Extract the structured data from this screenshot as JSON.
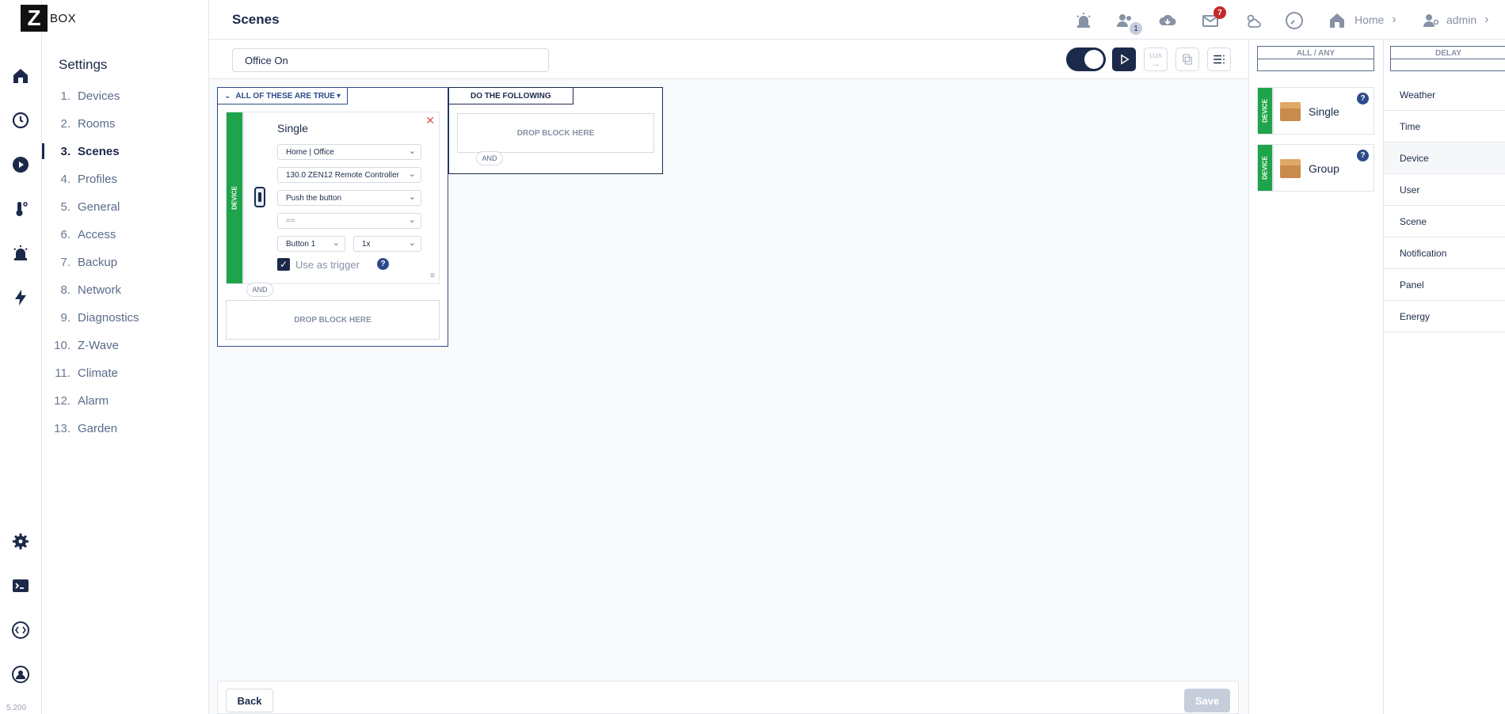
{
  "app": {
    "logo_letter": "Z",
    "logo_text": "BOX",
    "version": "5.200"
  },
  "header": {
    "title": "Scenes",
    "notifications_badge": "7",
    "users_badge": "1",
    "home_label": "Home",
    "user_label": "admin"
  },
  "settings": {
    "title": "Settings",
    "items": [
      {
        "num": "1.",
        "label": "Devices"
      },
      {
        "num": "2.",
        "label": "Rooms"
      },
      {
        "num": "3.",
        "label": "Scenes"
      },
      {
        "num": "4.",
        "label": "Profiles"
      },
      {
        "num": "5.",
        "label": "General"
      },
      {
        "num": "6.",
        "label": "Access"
      },
      {
        "num": "7.",
        "label": "Backup"
      },
      {
        "num": "8.",
        "label": "Network"
      },
      {
        "num": "9.",
        "label": "Diagnostics"
      },
      {
        "num": "10.",
        "label": "Z-Wave"
      },
      {
        "num": "11.",
        "label": "Climate"
      },
      {
        "num": "12.",
        "label": "Alarm"
      },
      {
        "num": "13.",
        "label": "Garden"
      }
    ],
    "active_index": 2
  },
  "toolbar": {
    "scene_name": "Office On",
    "lua_label": "LUA"
  },
  "conditions": {
    "header": "ALL OF THESE ARE TRUE",
    "block": {
      "category": "DEVICE",
      "title": "Single",
      "room": "Home | Office",
      "device": "130.0 ZEN12 Remote Controller",
      "action": "Push the button",
      "operator": "==",
      "button": "Button 1",
      "count": "1x",
      "trigger_label": "Use as trigger",
      "help": "?"
    },
    "and_label": "AND",
    "drop_label": "DROP BLOCK HERE"
  },
  "actions": {
    "header": "DO THE FOLLOWING",
    "drop_label": "DROP BLOCK HERE",
    "and_label": "AND"
  },
  "footer": {
    "back_label": "Back",
    "save_label": "Save"
  },
  "palette": {
    "col_allany": "ALL / ANY",
    "col_delay": "DELAY",
    "cards": [
      {
        "category": "DEVICE",
        "label": "Single",
        "help": "?"
      },
      {
        "category": "DEVICE",
        "label": "Group",
        "help": "?"
      }
    ]
  },
  "categories": {
    "items": [
      "Weather",
      "Time",
      "Device",
      "User",
      "Scene",
      "Notification",
      "Panel",
      "Energy"
    ],
    "active": "Device"
  }
}
